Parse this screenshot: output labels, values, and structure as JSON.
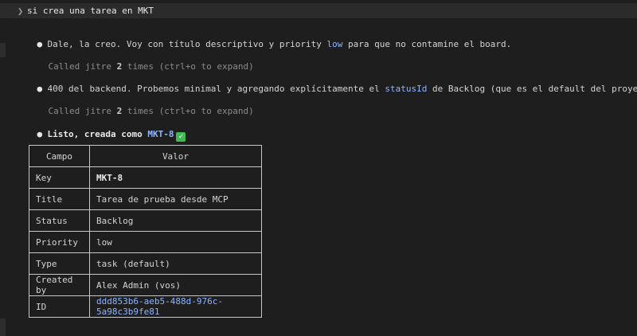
{
  "prompt": {
    "text": "si crea una tarea en MKT"
  },
  "messages": {
    "m1": {
      "before": "Dale, la creo. Voy con título descriptivo y priority ",
      "highlight": "low",
      "after": " para que no contamine el board."
    },
    "tool1": {
      "before": "Called jitre ",
      "count": "2",
      "after": " times (ctrl+o to expand)"
    },
    "m2": {
      "before": "400 del backend. Probemos minimal y agregando explícitamente el ",
      "highlight": "statusId",
      "after": " de Backlog (que es el default del proyecto)."
    },
    "tool2": {
      "before": "Called jitre ",
      "count": "2",
      "after": " times (ctrl+o to expand)"
    },
    "m3": {
      "before": "Listo, creada como ",
      "highlight": "MKT-8",
      "check": "✓"
    }
  },
  "bullet": "●",
  "table": {
    "headers": [
      "Campo",
      "Valor"
    ],
    "rows": [
      {
        "field": "Key",
        "value": "MKT-8"
      },
      {
        "field": "Title",
        "value": "Tarea de prueba desde MCP"
      },
      {
        "field": "Status",
        "value": "Backlog"
      },
      {
        "field": "Priority",
        "value": "low"
      },
      {
        "field": "Type",
        "value": "task (default)"
      },
      {
        "field": "Created by",
        "value": "Alex Admin (vos)"
      },
      {
        "field": "ID",
        "value": "ddd853b6-aeb5-488d-976c-5a98c3b9fe81"
      }
    ]
  },
  "colors": {
    "background": "#1e1e1e",
    "highlight": "#8fb5ff",
    "muted": "#8c8c8c",
    "check": "#3fb950"
  }
}
